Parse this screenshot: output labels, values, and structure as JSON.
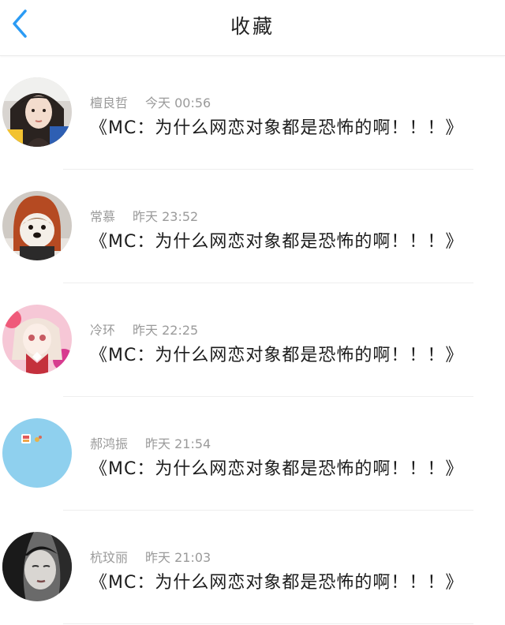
{
  "header": {
    "title": "收藏",
    "back_icon": "chevron-left-icon",
    "accent_color": "#2b9bf4"
  },
  "items": [
    {
      "name": "檀良哲",
      "time": "今天 00:56",
      "content": "《MC：为什么网恋对象都是恐怖的啊！！！》",
      "avatar": "avatar-girl-hat"
    },
    {
      "name": "常慕",
      "time": "昨天 23:52",
      "content": "《MC：为什么网恋对象都是恐怖的啊！！！》",
      "avatar": "avatar-dog-hood"
    },
    {
      "name": "冷环",
      "time": "昨天 22:25",
      "content": "《MC：为什么网恋对象都是恐怖的啊！！！》",
      "avatar": "avatar-anime-girl"
    },
    {
      "name": "郝鸿振",
      "time": "昨天 21:54",
      "content": "《MC：为什么网恋对象都是恐怖的啊！！！》",
      "avatar": "avatar-blue-sticker"
    },
    {
      "name": "杭玟丽",
      "time": "昨天 21:03",
      "content": "《MC：为什么网恋对象都是恐怖的啊！！！》",
      "avatar": "avatar-bw-portrait"
    }
  ]
}
